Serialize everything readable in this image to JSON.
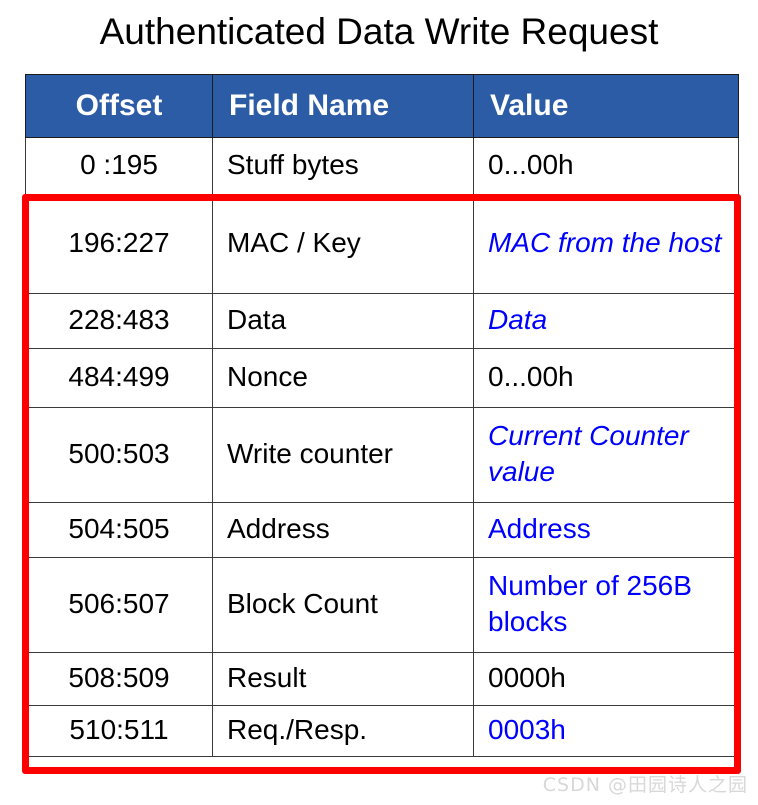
{
  "title": "Authenticated Data Write Request",
  "colors": {
    "header_bg": "#2d5ca6",
    "header_text": "#ffffff",
    "highlight_border": "#ff0000",
    "value_accent": "#0000ff",
    "grid": "#3a3a3a",
    "watermark": "#d8d8d8"
  },
  "table": {
    "columns": [
      {
        "label": "Offset"
      },
      {
        "label": "Field Name"
      },
      {
        "label": "Value"
      }
    ],
    "rows": [
      {
        "offset": "0 :195",
        "field": "Stuff bytes",
        "value": "0...00h",
        "value_style": "black",
        "highlighted": false
      },
      {
        "offset": "196:227",
        "field": "MAC / Key",
        "value": "MAC from the host",
        "value_style": "blue-italic",
        "highlighted": true
      },
      {
        "offset": "228:483",
        "field": "Data",
        "value": "Data",
        "value_style": "blue-italic",
        "highlighted": true
      },
      {
        "offset": "484:499",
        "field": "Nonce",
        "value": "0...00h",
        "value_style": "black",
        "highlighted": true
      },
      {
        "offset": "500:503",
        "field": "Write counter",
        "value": "Current Counter value",
        "value_style": "blue-italic",
        "highlighted": true
      },
      {
        "offset": "504:505",
        "field": "Address",
        "value": "Address",
        "value_style": "blue",
        "highlighted": true
      },
      {
        "offset": "506:507",
        "field": "Block Count",
        "value": "Number of 256B blocks",
        "value_style": "blue",
        "highlighted": true
      },
      {
        "offset": "508:509",
        "field": "Result",
        "value": "0000h",
        "value_style": "black",
        "highlighted": true
      },
      {
        "offset": "510:511",
        "field": "Req./Resp.",
        "value": "0003h",
        "value_style": "blue",
        "highlighted": true
      }
    ]
  },
  "watermark": "CSDN @田园诗人之园"
}
